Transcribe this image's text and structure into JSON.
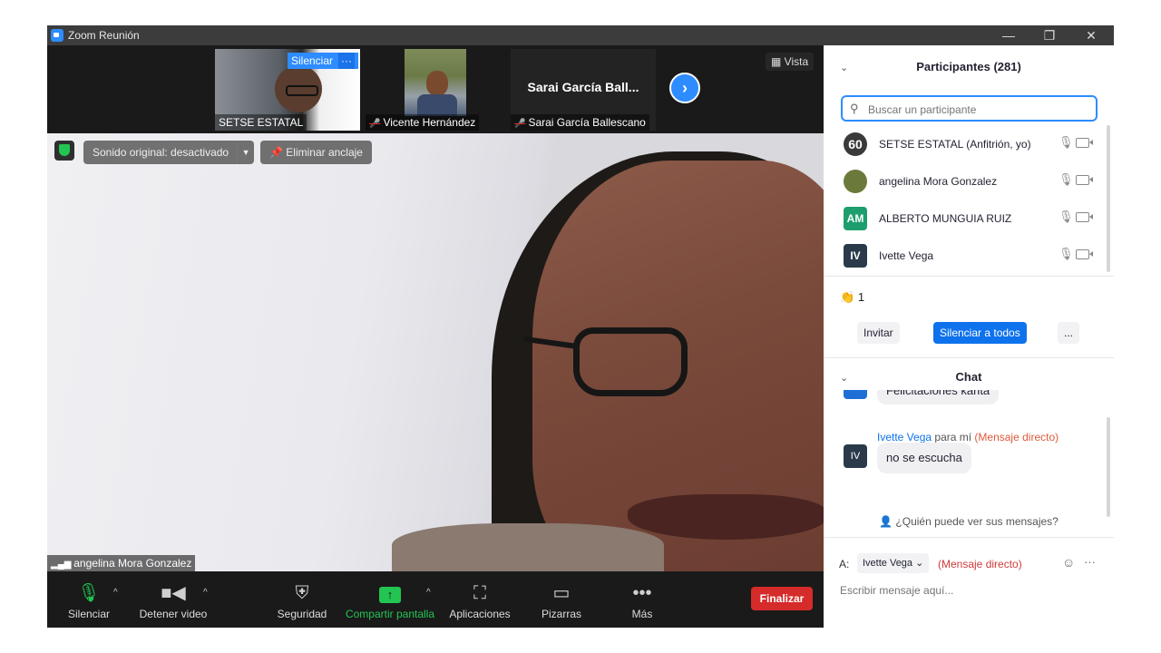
{
  "window": {
    "title": "Zoom Reunión"
  },
  "strip": {
    "thumbs": [
      {
        "name": "SETSE ESTATAL",
        "overlay_button": "Silenciar",
        "overlay_more": "···"
      },
      {
        "name": "Vicente Hernández"
      },
      {
        "name": "Sarai García Ballescano",
        "title_text": "Sarai García Ball..."
      }
    ],
    "view_label": "Vista"
  },
  "main_video": {
    "sound_label": "Sonido original: desactivado",
    "unpin_label": "Eliminar anclaje",
    "speaker_name": "angelina Mora Gonzalez"
  },
  "toolbar": {
    "mute": "Silenciar",
    "stop_video": "Detener video",
    "security": "Seguridad",
    "share": "Compartir pantalla",
    "apps": "Aplicaciones",
    "whiteboards": "Pizarras",
    "more": "Más",
    "end": "Finalizar"
  },
  "participants": {
    "header": "Participantes (281)",
    "search_placeholder": "Buscar un participante",
    "list": [
      {
        "name": "SETSE ESTATAL (Anfitrión, yo)",
        "avatar": "60",
        "color": "#3a3a3a"
      },
      {
        "name": "angelina Mora Gonzalez",
        "avatar": "",
        "color": "#6b7a3a"
      },
      {
        "name": "ALBERTO MUNGUIA RUIZ",
        "avatar": "AM",
        "color": "#1e9e6e"
      },
      {
        "name": "Ivette Vega",
        "avatar": "IV",
        "color": "#2b3a4a"
      }
    ],
    "raised_hands": "1",
    "invite": "Invitar",
    "mute_all": "Silenciar a todos",
    "more": "..."
  },
  "chat": {
    "header": "Chat",
    "partial_message": "Felicitaciones karita",
    "sender": "Ivette Vega",
    "to_me": "para mí",
    "direct_tag": "(Mensaje directo)",
    "avatar": "IV",
    "message": "no se escucha",
    "who_can_see": "¿Quién puede ver sus mensajes?",
    "to_label": "A:",
    "recipient": "Ivette Vega",
    "recipient_tag": "(Mensaje directo)",
    "input_placeholder": "Escribir mensaje aquí..."
  }
}
